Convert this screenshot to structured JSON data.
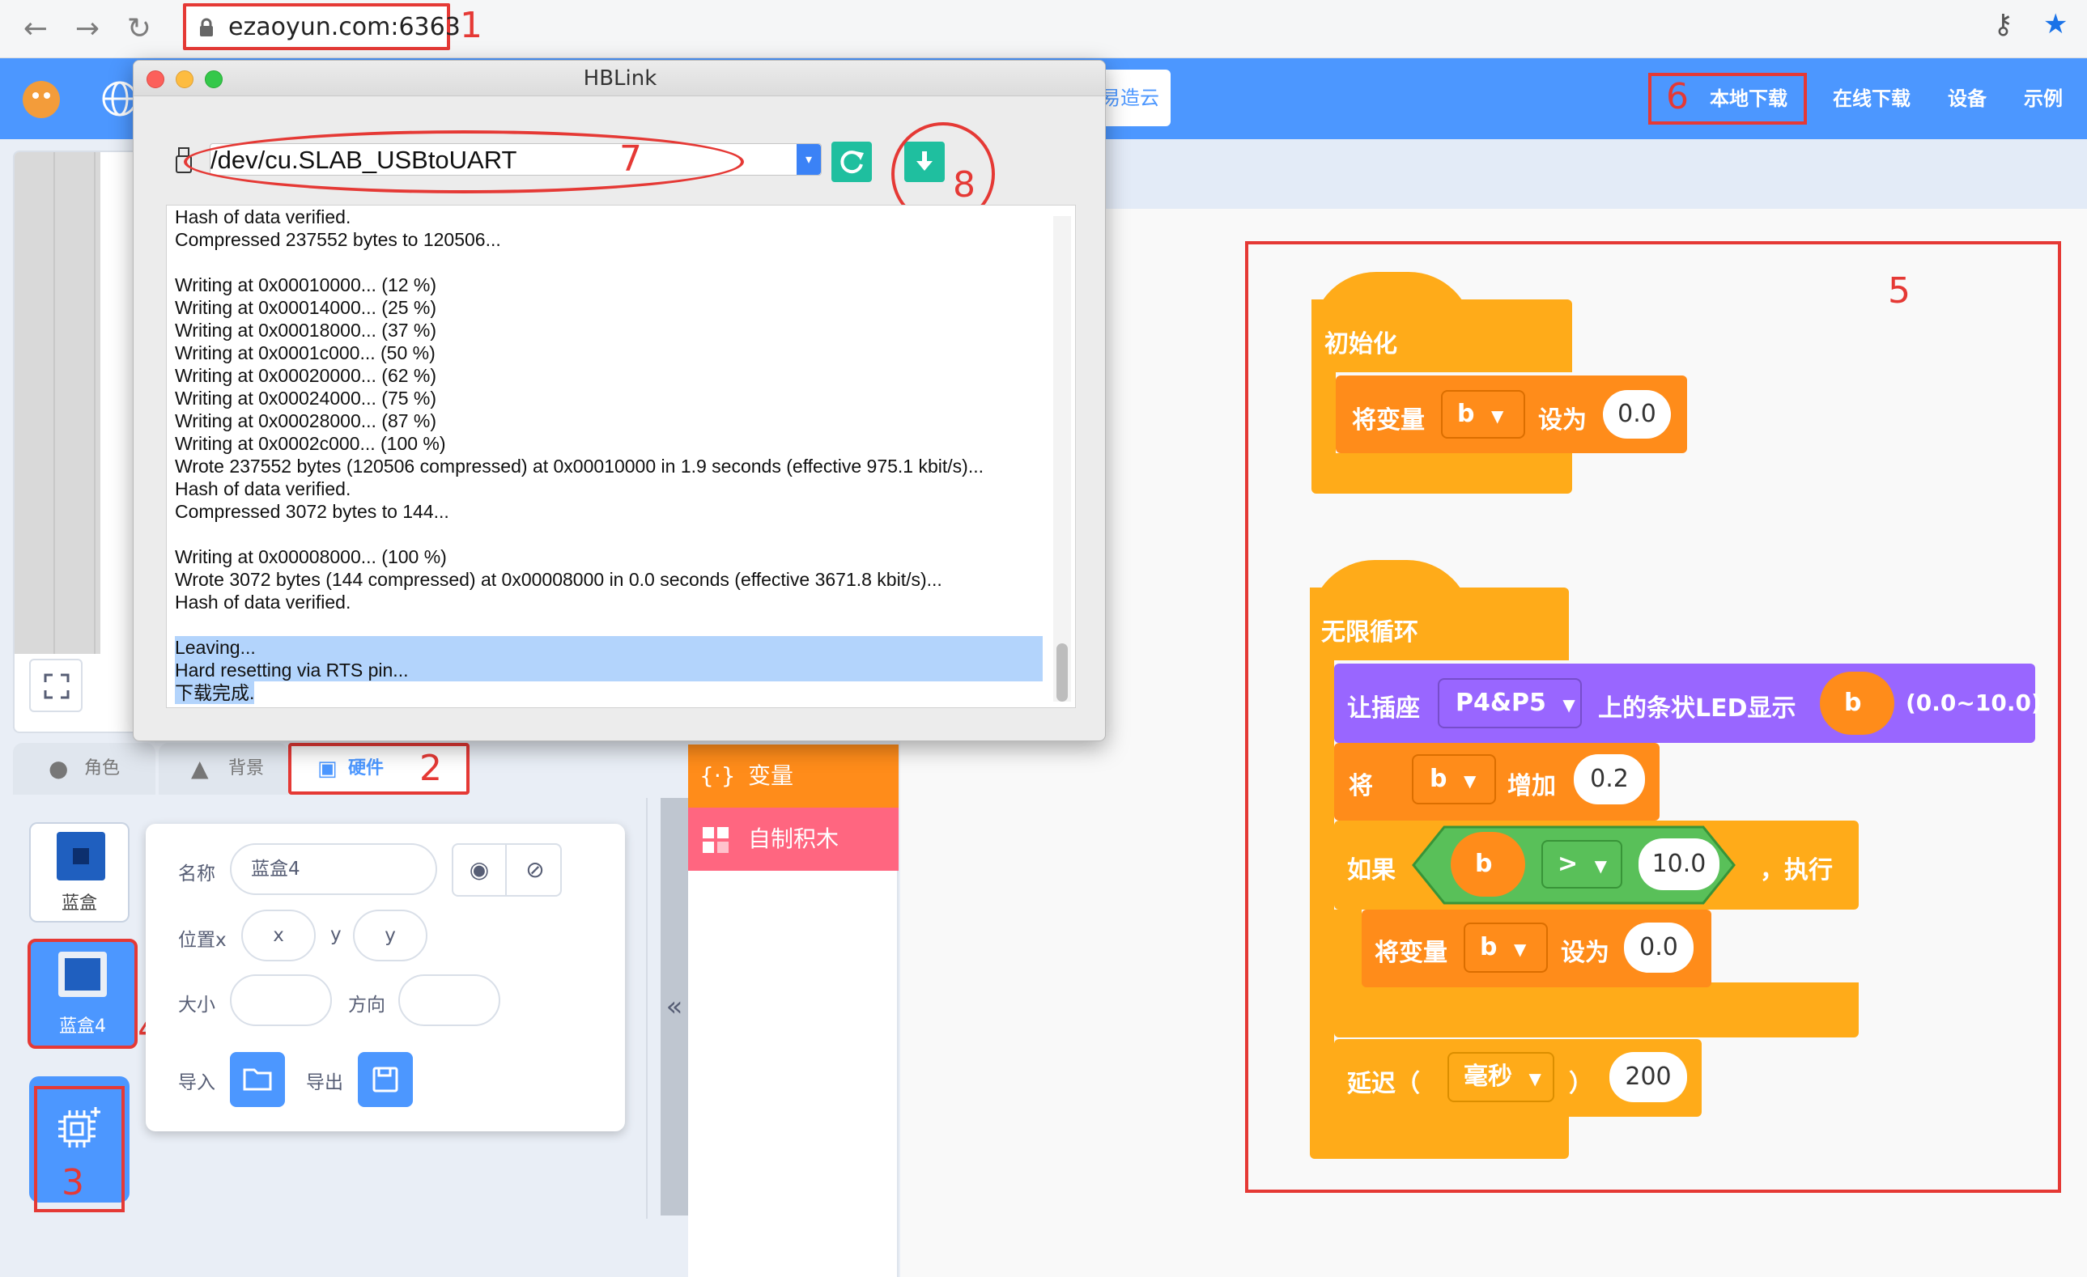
{
  "browser": {
    "url": "ezaoyun.com:6363",
    "back_icon": "←",
    "forward_icon": "→",
    "reload_icon": "↻",
    "key_icon": "⚷",
    "star_icon": "★"
  },
  "annotations": {
    "n1": "1",
    "n2": "2",
    "n3": "3",
    "n4": "4",
    "n5": "5",
    "n6": "6",
    "n7": "7",
    "n8": "8"
  },
  "app_menu": {
    "partial_logo": "易造云",
    "local_download": "本地下载",
    "online_download": "在线下载",
    "device": "设备",
    "examples": "示例"
  },
  "dialog": {
    "title": "HBLink",
    "port": "/dev/cu.SLAB_USBtoUART",
    "log_lines": [
      "Hash of data verified.",
      "Compressed 237552 bytes to 120506...",
      "",
      "Writing at 0x00010000... (12 %)",
      "Writing at 0x00014000... (25 %)",
      "Writing at 0x00018000... (37 %)",
      "Writing at 0x0001c000... (50 %)",
      "Writing at 0x00020000... (62 %)",
      "Writing at 0x00024000... (75 %)",
      "Writing at 0x00028000... (87 %)",
      "Writing at 0x0002c000... (100 %)",
      "Wrote 237552 bytes (120506 compressed) at 0x00010000 in 1.9 seconds (effective 975.1 kbit/s)...",
      "Hash of data verified.",
      "Compressed 3072 bytes to 144...",
      "",
      "Writing at 0x00008000... (100 %)",
      "Wrote 3072 bytes (144 compressed) at 0x00008000 in 0.0 seconds (effective 3671.8 kbit/s)...",
      "Hash of data verified.",
      "",
      "Leaving...",
      "Hard resetting via RTS pin...",
      "下载完成."
    ]
  },
  "tabs": {
    "sprite": "角色",
    "backdrop": "背景",
    "hardware": "硬件"
  },
  "sprites": {
    "item1": "蓝盒",
    "item2": "蓝盒4"
  },
  "props": {
    "name_label": "名称",
    "name_value": "蓝盒4",
    "posx_label": "位置x",
    "x_placeholder": "x",
    "y_label": "y",
    "y_placeholder": "y",
    "size_label": "大小",
    "dir_label": "方向",
    "import_label": "导入",
    "export_label": "导出"
  },
  "palette": {
    "variables": "变量",
    "my_blocks": "自制积木",
    "collapse": "«"
  },
  "blocks": {
    "init_hat": "初始化",
    "set_var": "将变量",
    "var_b": "b",
    "set_to": "设为",
    "val_0": "0.0",
    "loop_hat": "无限循环",
    "led_prefix": "让插座",
    "port": "P4&P5",
    "led_mid": "上的条状LED显示",
    "led_suffix": "(0.0~10.0)",
    "change_prefix": "将",
    "change_by": "增加",
    "change_val": "0.2",
    "if_label": "如果",
    "op": ">",
    "cmp_val": "10.0",
    "then_label": "，执行",
    "wait_label": "延迟（",
    "unit": "毫秒",
    "wait_close": "）",
    "wait_val": "200"
  },
  "colors": {
    "accent_blue": "#4c97ff",
    "block_orange": "#ffab19",
    "block_dark_orange": "#ff8c1a",
    "block_purple": "#9966ff",
    "block_green": "#59c059",
    "myblocks_pink": "#ff6680",
    "annotation_red": "#e53935"
  }
}
